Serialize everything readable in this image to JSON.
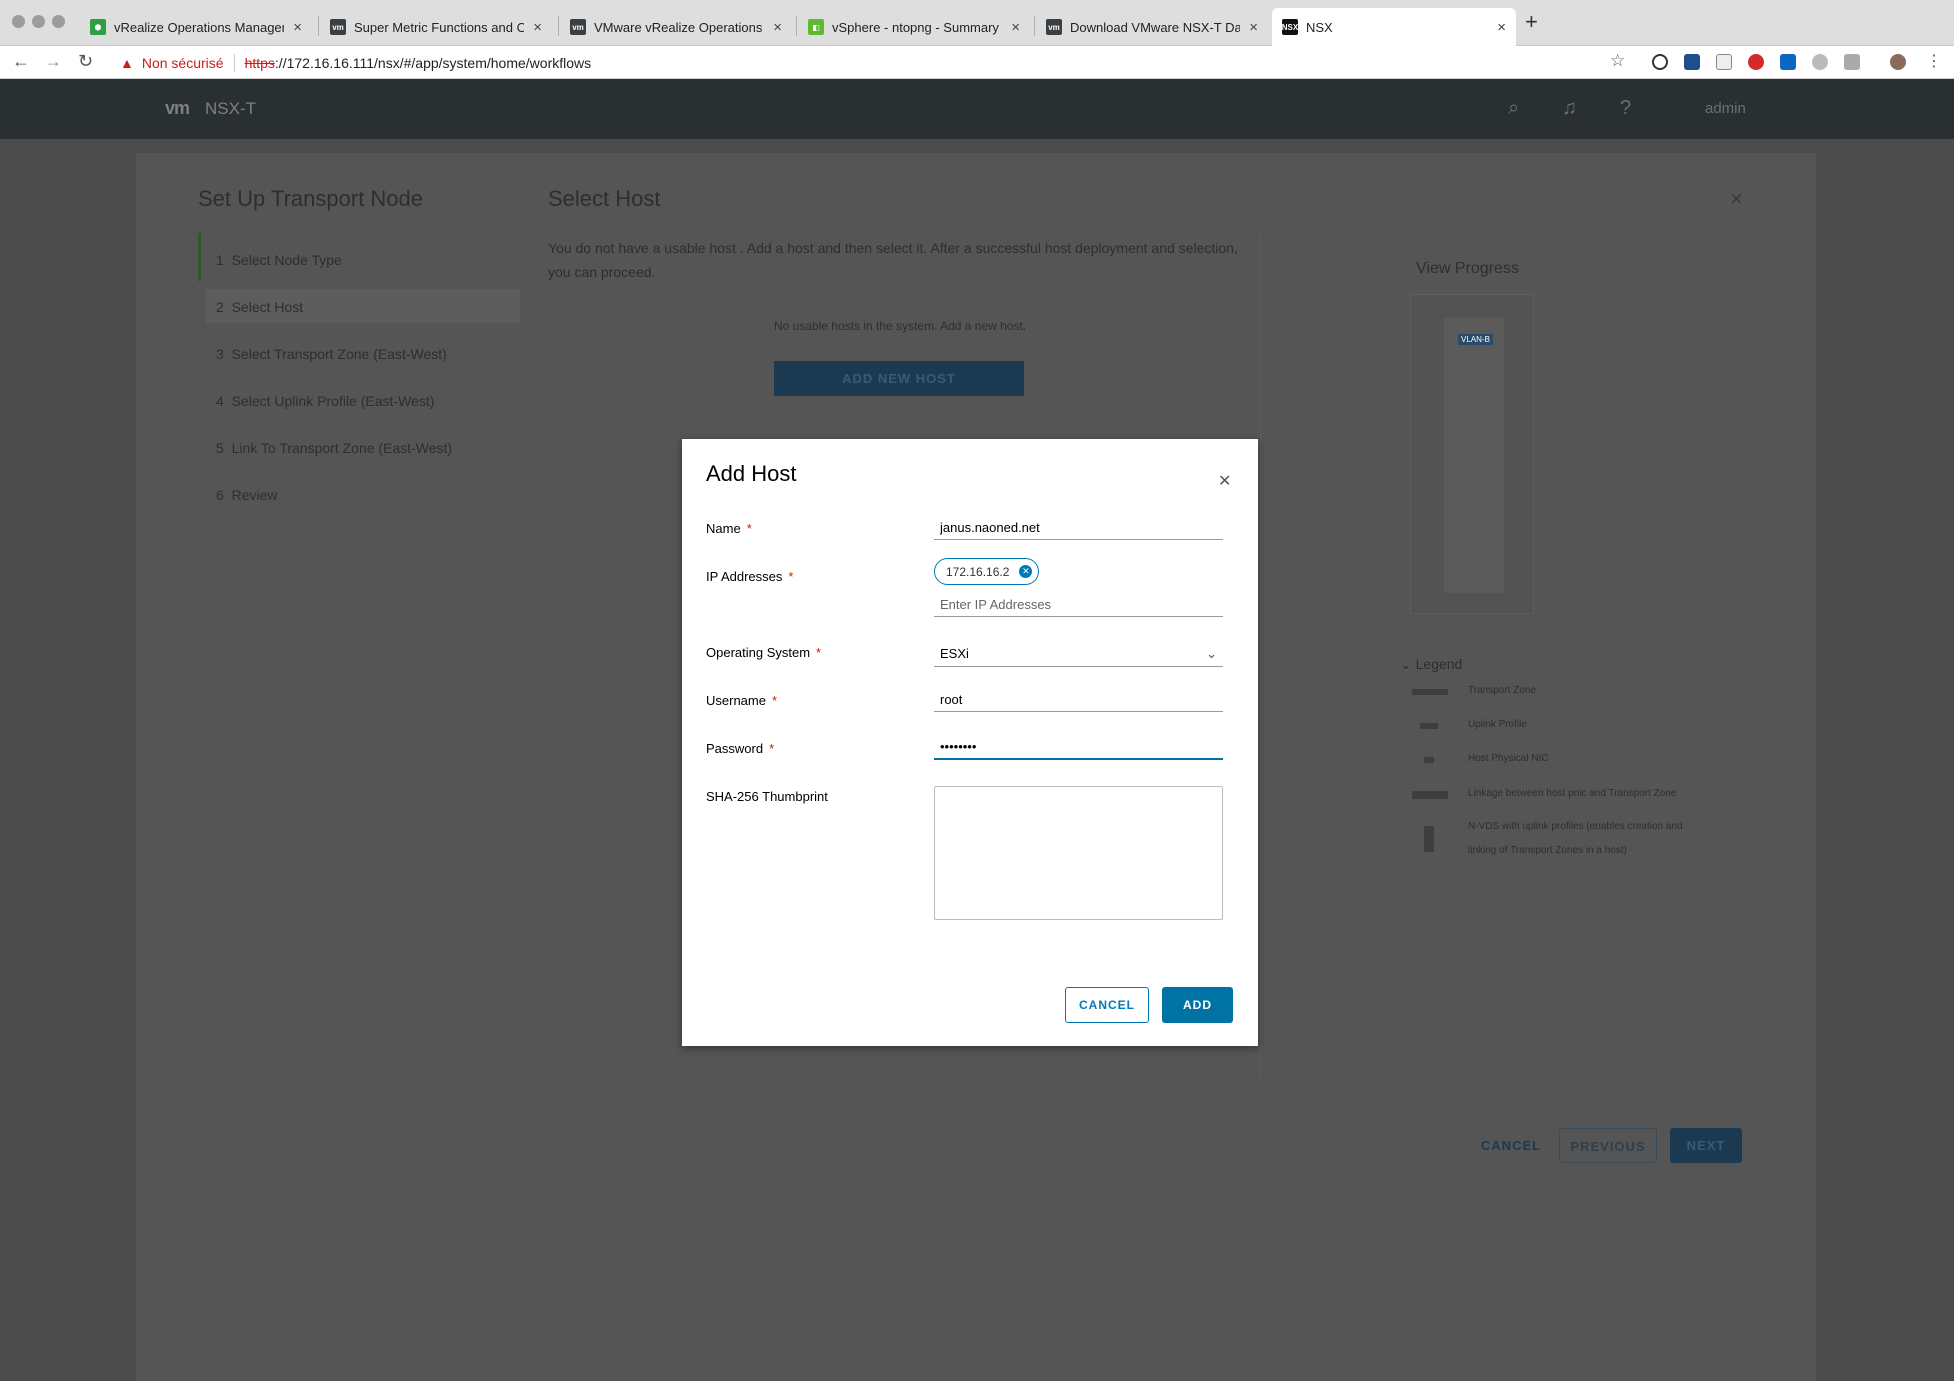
{
  "browser": {
    "tabs": [
      {
        "title": "vRealize Operations Manager",
        "favicon": "vrops-favicon",
        "color": "#2ea043"
      },
      {
        "title": "Super Metric Functions and Op",
        "favicon": "vm-favicon",
        "color": "#3a3f44"
      },
      {
        "title": "VMware vRealize Operations (v",
        "favicon": "vm-favicon",
        "color": "#3a3f44"
      },
      {
        "title": "vSphere - ntopng - Summary",
        "favicon": "vsphere-favicon",
        "color": "#5fb832"
      },
      {
        "title": "Download VMware NSX-T Data",
        "favicon": "vm-favicon",
        "color": "#3a3f44"
      },
      {
        "title": "NSX",
        "favicon": "nsx-favicon",
        "color": "#111111"
      }
    ],
    "security_label": "Non sécurisé",
    "url_scheme": "https",
    "url_rest": "://172.16.16.111/nsx/#/app/system/home/workflows"
  },
  "app": {
    "logo": "vm",
    "product": "NSX-T",
    "user": "admin"
  },
  "wizard": {
    "title": "Set Up Transport Node",
    "steps": [
      {
        "num": "1",
        "label": "Select Node Type"
      },
      {
        "num": "2",
        "label": "Select Host"
      },
      {
        "num": "3",
        "label": "Select Transport Zone (East-West)"
      },
      {
        "num": "4",
        "label": "Select Uplink Profile (East-West)"
      },
      {
        "num": "5",
        "label": "Link To Transport Zone (East-West)"
      },
      {
        "num": "6",
        "label": "Review"
      }
    ],
    "active_step": 2,
    "section_title": "Select Host",
    "description": "You do not have a usable host . Add a host and then select it. After a successful host deployment and selection, you can proceed.",
    "no_hosts": "No usable hosts in the system. Add a new host.",
    "add_new_host": "ADD NEW HOST",
    "view_progress": "View Progress",
    "vlan_badge": "VLAN-B",
    "legend": {
      "title": "Legend",
      "items": [
        "Transport Zone",
        "Uplink Profile",
        "Host Physical NIC",
        "Linkage between host pnic and Transport Zone",
        "N-VDS with uplink profiles (enables creation and",
        "linking of Transport Zones in a host)"
      ]
    },
    "buttons": {
      "cancel": "CANCEL",
      "previous": "PREVIOUS",
      "next": "NEXT"
    }
  },
  "modal": {
    "title": "Add Host",
    "fields": {
      "name": {
        "label": "Name",
        "value": "janus.naoned.net"
      },
      "ip": {
        "label": "IP Addresses",
        "chip": "172.16.16.2",
        "placeholder": "Enter IP Addresses"
      },
      "os": {
        "label": "Operating System",
        "value": "ESXi"
      },
      "username": {
        "label": "Username",
        "value": "root"
      },
      "password": {
        "label": "Password",
        "value": "••••••••"
      },
      "thumbprint": {
        "label": "SHA-256 Thumbprint",
        "value": ""
      }
    },
    "buttons": {
      "cancel": "CANCEL",
      "add": "ADD"
    }
  }
}
